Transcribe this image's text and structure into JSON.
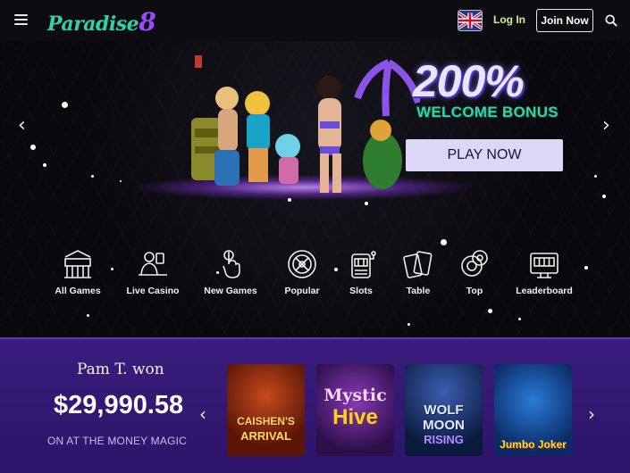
{
  "header": {
    "logo_text": "Paradise",
    "logo_suffix": "8",
    "language": "English",
    "login_label": "Log In",
    "join_label": "Join Now"
  },
  "hero": {
    "bonus_percent": "200%",
    "bonus_text": "WELCOME BONUS",
    "cta_label": "PLAY NOW"
  },
  "categories": [
    {
      "label": "All Games",
      "icon": "casino-building-icon"
    },
    {
      "label": "Live Casino",
      "icon": "dealer-icon"
    },
    {
      "label": "New Games",
      "icon": "pointing-hand-icon"
    },
    {
      "label": "Popular",
      "icon": "roulette-icon"
    },
    {
      "label": "Slots",
      "icon": "slot-machine-icon"
    },
    {
      "label": "Table",
      "icon": "playing-cards-icon"
    },
    {
      "label": "Top",
      "icon": "chips-icon"
    },
    {
      "label": "Leaderboard",
      "icon": "scoreboard-icon"
    }
  ],
  "winner": {
    "name_text": "Pam T. won",
    "amount": "$29,990.58",
    "game_text": "ON AT THE MONEY MAGIC"
  },
  "games": [
    {
      "line1": "CAISHEN'S",
      "line2": "ARRIVAL"
    },
    {
      "line1": "Mystic",
      "line2": "Hive"
    },
    {
      "line1": "WOLF",
      "line2": "MOON",
      "line3": "RISING"
    },
    {
      "line1": "Jumbo Joker"
    }
  ],
  "colors": {
    "brand_green": "#2fd3a5",
    "brand_purple": "#9a49ff",
    "login_green": "#c8f28f",
    "strip_purple": "#3a1d7d",
    "cta_bg": "#ded6f6"
  }
}
